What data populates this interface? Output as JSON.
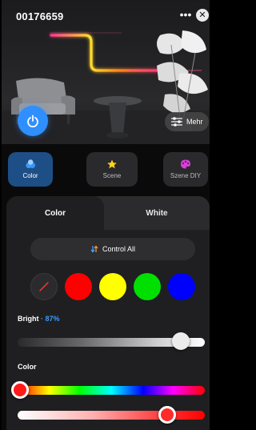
{
  "header": {
    "title": "00176659",
    "more_icon": "ellipsis-icon",
    "close_icon": "close-icon",
    "power_icon": "power-icon",
    "more_button_label": "Mehr",
    "more_button_icon": "sliders-icon"
  },
  "mode_tabs": [
    {
      "label": "Color",
      "icon": "color-circles-icon",
      "active": true,
      "icon_color": "#3d9bff"
    },
    {
      "label": "Scene",
      "icon": "star-icon",
      "active": false,
      "icon_color": "#ffd21f"
    },
    {
      "label": "Szene DIY",
      "icon": "palette-icon",
      "active": false,
      "icon_color": "#d83fd8"
    }
  ],
  "segment": {
    "color_label": "Color",
    "white_label": "White",
    "active": "Color"
  },
  "control_all": {
    "label": "Control All",
    "icon": "swap-icon"
  },
  "swatches": [
    {
      "name": "custom",
      "color": "#2b2b2d",
      "icon": "slash-icon"
    },
    {
      "name": "red",
      "color": "#ff0000"
    },
    {
      "name": "yellow",
      "color": "#ffff00"
    },
    {
      "name": "green",
      "color": "#00e000"
    },
    {
      "name": "blue",
      "color": "#0000ff"
    }
  ],
  "brightness": {
    "label": "Bright",
    "separator": "·",
    "value_text": "87%",
    "value": 0.87
  },
  "color": {
    "label": "Color",
    "hue_value": 0.0,
    "saturation_value": 0.8
  },
  "colors": {
    "accent": "#2f8fff",
    "panel": "#1f1f21",
    "background": "#0a0a0a"
  }
}
